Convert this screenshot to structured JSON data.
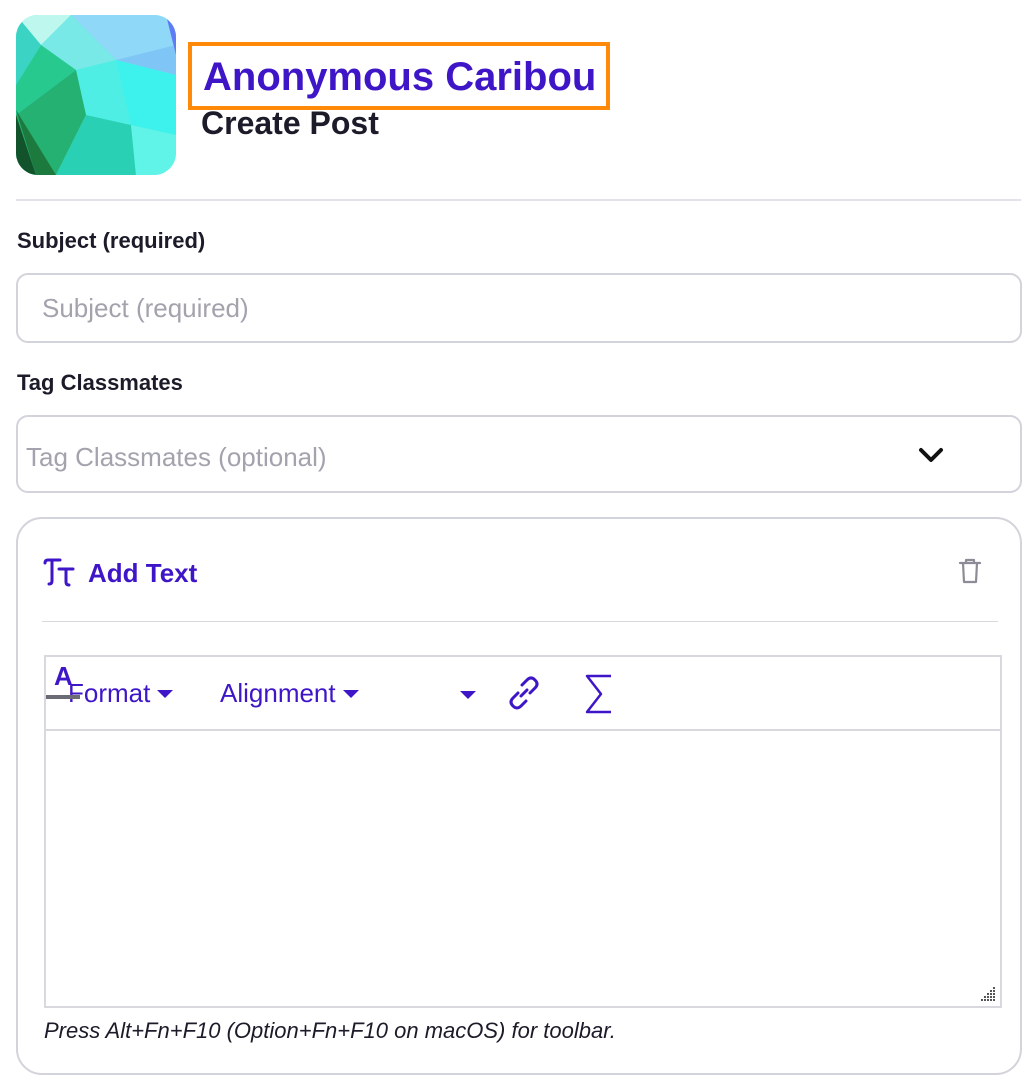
{
  "header": {
    "user_name": "Anonymous Caribou",
    "page_title": "Create Post",
    "highlight_color": "#ff8a0a"
  },
  "form": {
    "subject": {
      "label": "Subject (required)",
      "placeholder": "Subject (required)",
      "value": ""
    },
    "tag_classmates": {
      "label": "Tag Classmates",
      "placeholder": "Tag Classmates (optional)",
      "icon": "chevron-down-icon"
    }
  },
  "text_block": {
    "title": "Add Text",
    "title_icon": "text-format-icon",
    "delete_icon": "trash-icon",
    "toolbar": {
      "format_label": "Format",
      "alignment_label": "Alignment",
      "text_color_letter": "A",
      "link_icon": "link-icon",
      "equation_icon": "sigma-icon"
    },
    "content": "",
    "hint": "Press Alt+Fn+F10 (Option+Fn+F10 on macOS) for toolbar."
  },
  "colors": {
    "accent": "#3f16c7",
    "text": "#1b1b29",
    "border": "#d3d3dc",
    "placeholder": "#a3a3ae"
  }
}
